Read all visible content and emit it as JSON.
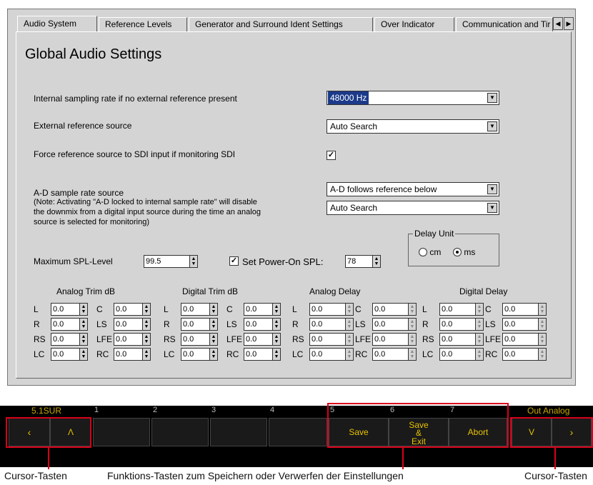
{
  "tabs": [
    {
      "label": "Audio System",
      "active": true
    },
    {
      "label": "Reference Levels",
      "active": false
    },
    {
      "label": "Generator and Surround Ident Settings",
      "active": false
    },
    {
      "label": "Over Indicator",
      "active": false
    },
    {
      "label": "Communication and Tir",
      "active": false
    }
  ],
  "page_title": "Global Audio Settings",
  "settings": {
    "sampling_rate_label": "Internal sampling rate if no external reference present",
    "sampling_rate_value": "48000 Hz",
    "ext_ref_label": "External reference source",
    "ext_ref_value": "Auto Search",
    "force_sdi_label": "Force reference source to SDI input if monitoring SDI",
    "force_sdi_checked": "✓",
    "ad_label": "A-D sample rate source",
    "ad_note_1": "(Note: Activating \"A-D locked to internal sample rate\" will disable",
    "ad_note_2": "the downmix from a digital input source during the time an analog",
    "ad_note_3": "source is selected for monitoring)",
    "ad_value_1": "A-D follows reference below",
    "ad_value_2": "Auto Search",
    "delay_unit_title": "Delay Unit",
    "delay_unit_cm": "cm",
    "delay_unit_ms": "ms",
    "delay_unit_selected": "ms",
    "max_spl_label": "Maximum SPL-Level",
    "max_spl_value": "99.5",
    "power_on_spl_checked": "✓",
    "power_on_spl_label": "Set Power-On SPL:",
    "power_on_spl_value": "78"
  },
  "trim_groups": [
    {
      "title": "Analog Trim dB",
      "col1": [
        [
          "L",
          "0.0"
        ],
        [
          "R",
          "0.0"
        ],
        [
          "RS",
          "0.0"
        ],
        [
          "LC",
          "0.0"
        ]
      ],
      "col2": [
        [
          "C",
          "0.0"
        ],
        [
          "LS",
          "0.0"
        ],
        [
          "LFE",
          "0.0"
        ],
        [
          "RC",
          "0.0"
        ]
      ]
    },
    {
      "title": "Digital Trim dB",
      "col1": [
        [
          "L",
          "0.0"
        ],
        [
          "R",
          "0.0"
        ],
        [
          "RS",
          "0.0"
        ],
        [
          "LC",
          "0.0"
        ]
      ],
      "col2": [
        [
          "C",
          "0.0"
        ],
        [
          "LS",
          "0.0"
        ],
        [
          "LFE",
          "0.0"
        ],
        [
          "RC",
          "0.0"
        ]
      ]
    },
    {
      "title": "Analog Delay",
      "col1": [
        [
          "L",
          "0.0"
        ],
        [
          "R",
          "0.0"
        ],
        [
          "RS",
          "0.0"
        ],
        [
          "LC",
          "0.0"
        ]
      ],
      "col2": [
        [
          "C",
          "0.0"
        ],
        [
          "LS",
          "0.0"
        ],
        [
          "LFE",
          "0.0"
        ],
        [
          "RC",
          "0.0"
        ]
      ]
    },
    {
      "title": "Digital Delay",
      "col1": [
        [
          "L",
          "0.0"
        ],
        [
          "R",
          "0.0"
        ],
        [
          "RS",
          "0.0"
        ],
        [
          "LC",
          "0.0"
        ]
      ],
      "col2": [
        [
          "C",
          "0.0"
        ],
        [
          "LS",
          "0.0"
        ],
        [
          "LFE",
          "0.0"
        ],
        [
          "RC",
          "0.0"
        ]
      ]
    }
  ],
  "keybar": {
    "left_label": "5.1SUR",
    "right_label": "Out Analog",
    "numbers": [
      "1",
      "2",
      "3",
      "4",
      "5",
      "6",
      "7"
    ],
    "save": "Save",
    "save_exit_1": "Save",
    "save_exit_2": "&",
    "save_exit_3": "Exit",
    "abort": "Abort",
    "cursor_left": "‹",
    "cursor_up": "Λ",
    "cursor_down": "V",
    "cursor_right": "›"
  },
  "captions": {
    "left": "Cursor-Tasten",
    "center": "Funktions-Tasten zum Speichern oder Verwerfen der Einstellungen",
    "right": "Cursor-Tasten"
  },
  "colors": {
    "panel": "#d4d4d4",
    "selection": "#1c3a8a",
    "keybar": "#000000",
    "key_text": "#e6c200",
    "highlight": "#d9001b"
  }
}
